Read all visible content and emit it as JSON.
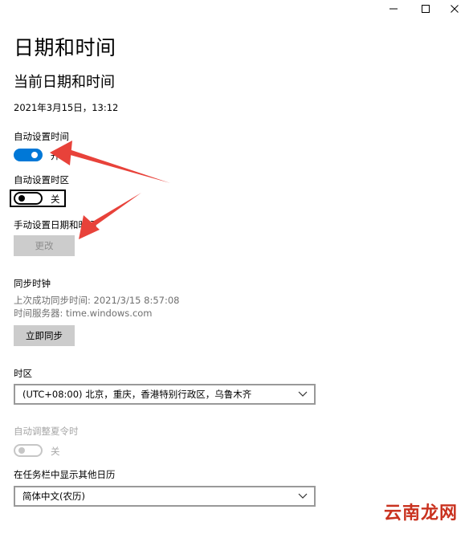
{
  "window": {
    "controls": [
      "minimize",
      "maximize",
      "close"
    ]
  },
  "page": {
    "title": "日期和时间",
    "section_title": "当前日期和时间",
    "current_datetime": "2021年3月15日，13:12"
  },
  "auto_time": {
    "label": "自动设置时间",
    "state": "开",
    "on": true
  },
  "auto_timezone": {
    "label": "自动设置时区",
    "state": "关",
    "on": false
  },
  "manual": {
    "label": "手动设置日期和时间",
    "change_button": "更改"
  },
  "sync": {
    "title": "同步时钟",
    "last_sync": "上次成功同步时间: 2021/3/15 8:57:08",
    "server": "时间服务器: time.windows.com",
    "sync_button": "立即同步"
  },
  "timezone": {
    "label": "时区",
    "selected": "(UTC+08:00) 北京，重庆，香港特别行政区，乌鲁木齐"
  },
  "dst": {
    "label": "自动调整夏令时",
    "state": "关",
    "on": false,
    "enabled": false
  },
  "calendar": {
    "label": "在任务栏中显示其他日历",
    "selected": "简体中文(农历)"
  },
  "watermark": {
    "text": "云南龙网"
  },
  "colors": {
    "accent": "#0078d7",
    "annotation_arrow": "#e8423a",
    "watermark": "#c9321f"
  },
  "icons": {
    "minimize": "minimize-icon",
    "maximize": "maximize-icon",
    "close": "close-icon",
    "dropdown": "chevron-down-icon"
  }
}
